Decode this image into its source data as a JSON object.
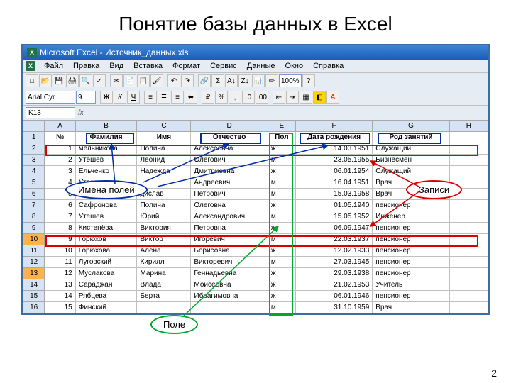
{
  "slide": {
    "title": "Понятие базы данных в Excel",
    "page_number": "2"
  },
  "window": {
    "app": "Microsoft Excel",
    "filename": "Источник_данных.xls",
    "title": "Microsoft Excel - Источник_данных.xls"
  },
  "menubar": {
    "file": "Файл",
    "edit": "Правка",
    "view": "Вид",
    "insert": "Вставка",
    "format": "Формат",
    "tools": "Сервис",
    "data": "Данные",
    "window": "Окно",
    "help": "Справка"
  },
  "format_bar": {
    "font": "Arial Cyr",
    "size": "9",
    "zoom": "100%"
  },
  "namebox": {
    "value": "K13"
  },
  "columns": [
    "A",
    "B",
    "C",
    "D",
    "E",
    "F",
    "G",
    "H"
  ],
  "header_row": {
    "num": "№",
    "surname": "Фамилия",
    "name": "Имя",
    "patronymic": "Отчество",
    "sex": "Пол",
    "dob": "Дата рождения",
    "occupation": "Род занятий"
  },
  "rows": [
    {
      "n": "1",
      "s": "мельникова",
      "i": "Полина",
      "o": "Алексеевна",
      "p": "ж",
      "d": "14.03.1951",
      "r": "Служащий"
    },
    {
      "n": "2",
      "s": "Утешев",
      "i": "Леонид",
      "o": "Олегович",
      "p": "м",
      "d": "23.05.1955",
      "r": "Бизнесмен"
    },
    {
      "n": "3",
      "s": "Ельченко",
      "i": "Надежда",
      "o": "Дмитриевна",
      "p": "ж",
      "d": "06.01.1954",
      "r": "Служащий"
    },
    {
      "n": "4",
      "s": "Утешев",
      "i": "",
      "o": "Андреевич",
      "p": "м",
      "d": "16.04.1951",
      "r": "Врач"
    },
    {
      "n": "5",
      "s": "",
      "i": "дислав",
      "o": "Петрович",
      "p": "м",
      "d": "15.03.1958",
      "r": "Врач"
    },
    {
      "n": "6",
      "s": "Сафронова",
      "i": "Полина",
      "o": "Олеговна",
      "p": "ж",
      "d": "01.05.1940",
      "r": "пенсионер"
    },
    {
      "n": "7",
      "s": "Утешев",
      "i": "Юрий",
      "o": "Александрович",
      "p": "м",
      "d": "15.05.1952",
      "r": "Инженер"
    },
    {
      "n": "8",
      "s": "Кистенёва",
      "i": "Виктория",
      "o": "Петровна",
      "p": "ж",
      "d": "06.09.1947",
      "r": "пенсионер"
    },
    {
      "n": "9",
      "s": "Горюхов",
      "i": "Виктор",
      "o": "Игоревич",
      "p": "м",
      "d": "22.03.1937",
      "r": "пенсионер"
    },
    {
      "n": "10",
      "s": "Горюхова",
      "i": "Алёна",
      "o": "Борисовна",
      "p": "ж",
      "d": "12.02.1933",
      "r": "пенсионер"
    },
    {
      "n": "11",
      "s": "Луговский",
      "i": "Кирилл",
      "o": "Викторевич",
      "p": "м",
      "d": "27.03.1945",
      "r": "пенсионер"
    },
    {
      "n": "12",
      "s": "Муслакова",
      "i": "Марина",
      "o": "Геннадьевна",
      "p": "ж",
      "d": "29.03.1938",
      "r": "пенсионер"
    },
    {
      "n": "13",
      "s": "Сараджан",
      "i": "Влада",
      "o": "Моисеевна",
      "p": "ж",
      "d": "21.02.1953",
      "r": "Учитель"
    },
    {
      "n": "14",
      "s": "Рябцева",
      "i": "Берта",
      "o": "Ибрагимовна",
      "p": "ж",
      "d": "06.01.1946",
      "r": "пенсионер"
    },
    {
      "n": "15",
      "s": "Финский",
      "i": "",
      "o": "",
      "p": "м",
      "d": "31.10.1959",
      "r": "Врач"
    }
  ],
  "callouts": {
    "fields": "Имена полей",
    "field": "Поле",
    "records": "Записи"
  }
}
